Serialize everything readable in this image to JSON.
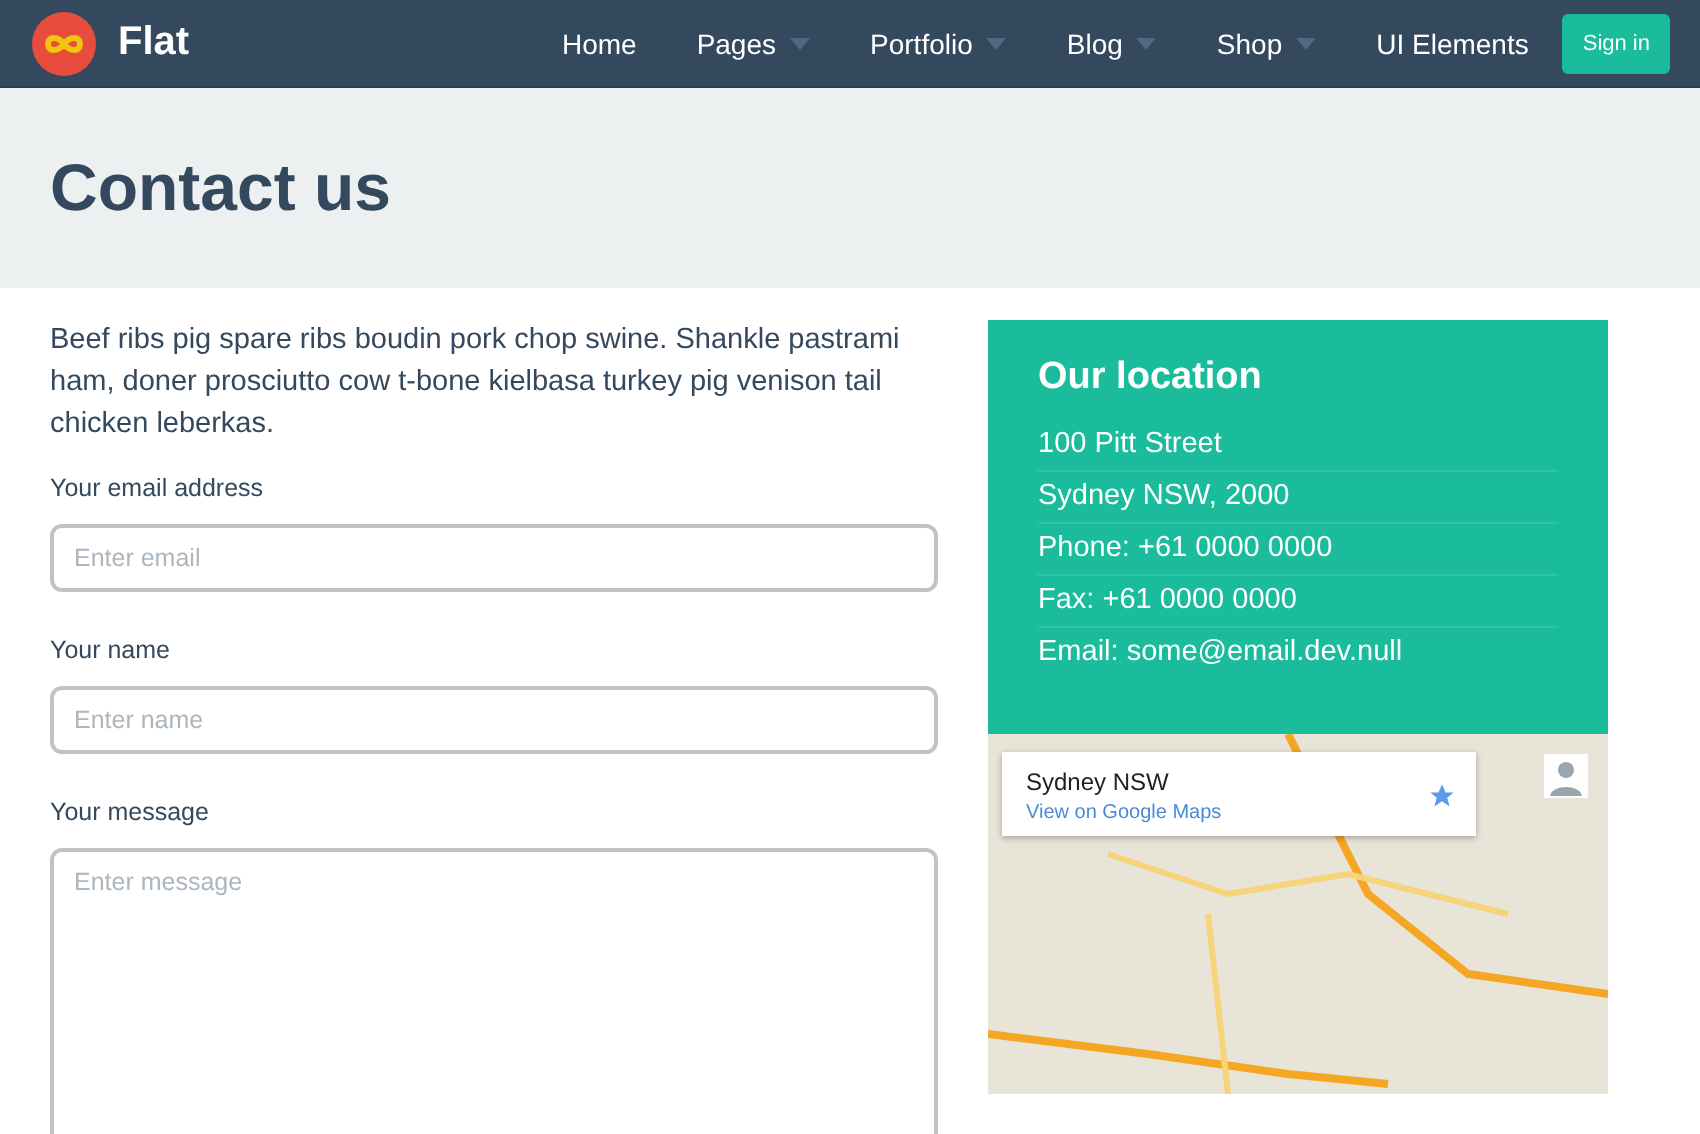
{
  "navbar": {
    "brand": "Flat",
    "items": [
      {
        "label": "Home",
        "has_dropdown": false
      },
      {
        "label": "Pages",
        "has_dropdown": true
      },
      {
        "label": "Portfolio",
        "has_dropdown": true
      },
      {
        "label": "Blog",
        "has_dropdown": true
      },
      {
        "label": "Shop",
        "has_dropdown": true
      },
      {
        "label": "UI Elements",
        "has_dropdown": false
      }
    ],
    "sign_in": "Sign in"
  },
  "page_title": "Contact us",
  "intro": "Beef ribs pig spare ribs boudin pork chop swine. Shankle pastrami ham, doner prosciutto cow t-bone kielbasa turkey pig venison tail chicken leberkas.",
  "form": {
    "fields": [
      {
        "label": "Your email address",
        "placeholder": "Enter email",
        "kind": "input"
      },
      {
        "label": "Your name",
        "placeholder": "Enter name",
        "kind": "input"
      },
      {
        "label": "Your message",
        "placeholder": "Enter message",
        "kind": "textarea"
      }
    ]
  },
  "location": {
    "title": "Our location",
    "lines": [
      "100 Pitt Street",
      "Sydney NSW, 2000",
      "Phone: +61 0000 0000",
      "Fax: +61 0000 0000",
      "Email: some@email.dev.null"
    ]
  },
  "map": {
    "place": "Sydney NSW",
    "link": "View on Google Maps"
  }
}
